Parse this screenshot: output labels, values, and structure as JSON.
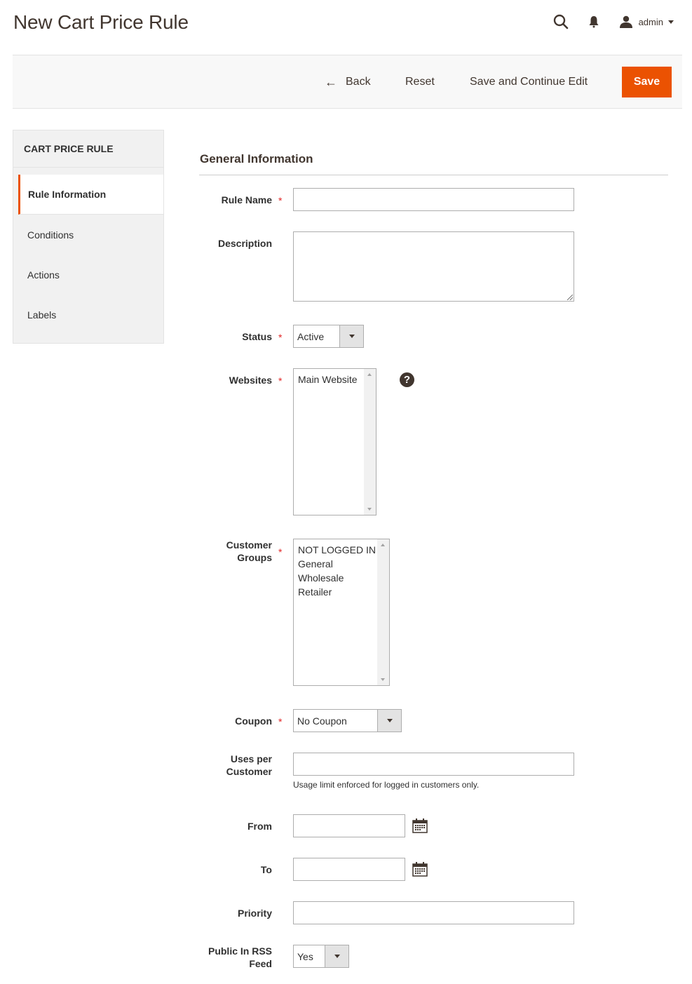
{
  "page": {
    "title": "New Cart Price Rule"
  },
  "header": {
    "search_icon": "search-icon",
    "notifications_icon": "bell-icon",
    "user": {
      "name": "admin",
      "icon": "user-icon"
    }
  },
  "toolbar": {
    "back_label": "Back",
    "reset_label": "Reset",
    "save_continue_label": "Save and Continue Edit",
    "save_label": "Save",
    "accent_color": "#eb5202"
  },
  "sidebar": {
    "title": "CART PRICE RULE",
    "items": [
      {
        "label": "Rule Information",
        "active": true
      },
      {
        "label": "Conditions",
        "active": false
      },
      {
        "label": "Actions",
        "active": false
      },
      {
        "label": "Labels",
        "active": false
      }
    ]
  },
  "form": {
    "section_title": "General Information",
    "required_mark": "*",
    "rule_name": {
      "label": "Rule Name",
      "value": "",
      "required": true
    },
    "description": {
      "label": "Description",
      "value": ""
    },
    "status": {
      "label": "Status",
      "value": "Active",
      "required": true
    },
    "websites": {
      "label": "Websites",
      "options": [
        "Main Website"
      ],
      "required": true,
      "help": "?"
    },
    "customer_groups": {
      "label_line1": "Customer",
      "label_line2": "Groups",
      "options": [
        "NOT LOGGED IN",
        "General",
        "Wholesale",
        "Retailer"
      ],
      "required": true
    },
    "coupon": {
      "label": "Coupon",
      "value": "No Coupon",
      "required": true
    },
    "uses_per_customer": {
      "label_line1": "Uses per",
      "label_line2": "Customer",
      "value": "",
      "note": "Usage limit enforced for logged in customers only."
    },
    "from": {
      "label": "From",
      "value": ""
    },
    "to": {
      "label": "To",
      "value": ""
    },
    "priority": {
      "label": "Priority",
      "value": ""
    },
    "public_in_rss": {
      "label_line1": "Public In RSS",
      "label_line2": "Feed",
      "value": "Yes"
    }
  }
}
